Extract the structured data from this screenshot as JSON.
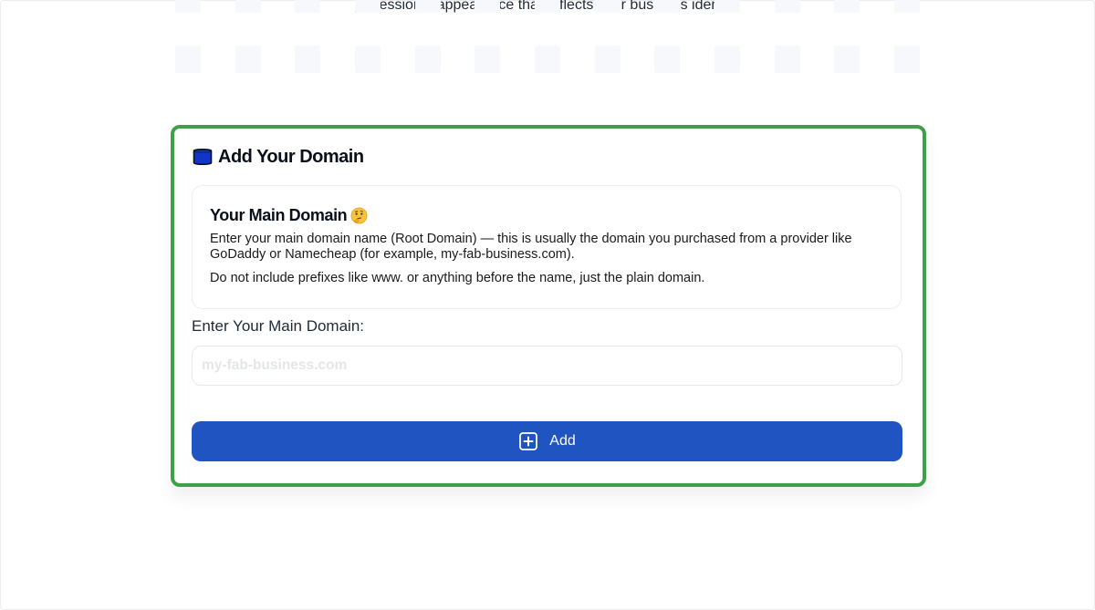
{
  "intro": {
    "text": "professional appearance that reflects your business identity."
  },
  "card": {
    "title": "Add Your Domain",
    "icon": "database-icon",
    "highlight_color": "#3ea048"
  },
  "info": {
    "title": "Your Main Domain",
    "emoji": "🤔",
    "paragraph_1": "Enter your main domain name (Root Domain) — this is usually the domain you purchased from a provider like GoDaddy or Namecheap (for example, my-fab-business.com).",
    "paragraph_2": "Do not include prefixes like www. or anything before the name, just the plain domain."
  },
  "form": {
    "label": "Enter Your Main Domain:",
    "value": "",
    "placeholder": "my-fab-business.com",
    "button_label": "Add",
    "button_icon": "plus-square-icon",
    "button_color": "#1f54c1"
  }
}
